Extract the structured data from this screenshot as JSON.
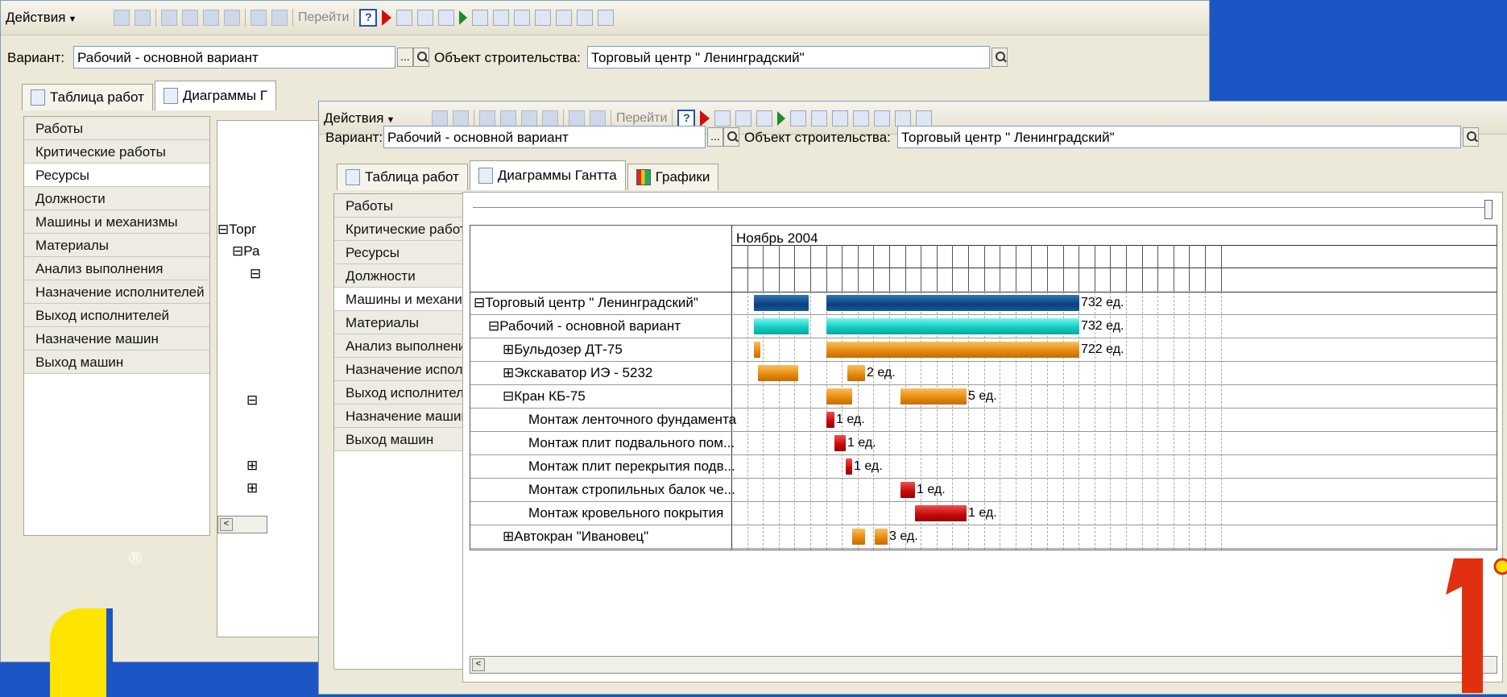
{
  "toolbar": {
    "actions_label": "Действия",
    "goto_label": "Перейти"
  },
  "variant": {
    "label": "Вариант:",
    "value": "Рабочий - основной вариант",
    "object_label": "Объект строительства:",
    "object_value": "Торговый центр \" Ленинградский\""
  },
  "tabs": [
    {
      "label": "Таблица работ"
    },
    {
      "label": "Диаграммы Гантта"
    },
    {
      "label": "Графики"
    }
  ],
  "back_tab_partial": "Диаграммы Г",
  "nav": [
    {
      "label": "Работы"
    },
    {
      "label": "Критические работы"
    },
    {
      "label": "Ресурсы"
    },
    {
      "label": "Должности"
    },
    {
      "label": "Машины и механизмы"
    },
    {
      "label": "Материалы"
    },
    {
      "label": "Анализ выполнения"
    },
    {
      "label": "Назначение исполнителей"
    },
    {
      "label": "Выход исполнителей"
    },
    {
      "label": "Назначение машин"
    },
    {
      "label": "Выход машин"
    }
  ],
  "back_tree": {
    "r1": "⊟Торг",
    "r2": "⊟Ра",
    "r3": "⊟",
    "r4": "⊟",
    "r5": "⊞",
    "r6": "⊞"
  },
  "gantt": {
    "month": "Ноябрь 2004",
    "rows": [
      {
        "name": "⊟Торговый центр \" Ленинградский\"",
        "qty": "732 ед."
      },
      {
        "name": "⊟Рабочий - основной вариант",
        "qty": "732 ед."
      },
      {
        "name": "⊞Бульдозер ДТ-75",
        "qty": "722 ед."
      },
      {
        "name": "⊞Экскаватор ИЭ - 5232",
        "qty": "2 ед."
      },
      {
        "name": "⊟Кран КБ-75",
        "qty": "5 ед."
      },
      {
        "name": "Монтаж ленточного фундамента",
        "qty": "1 ед."
      },
      {
        "name": "Монтаж плит подвального пом...",
        "qty": "1 ед."
      },
      {
        "name": "Монтаж плит перекрытия подв...",
        "qty": "1 ед."
      },
      {
        "name": "Монтаж стропильных балок че...",
        "qty": "1 ед."
      },
      {
        "name": "Монтаж кровельного покрытия",
        "qty": "1 ед."
      },
      {
        "name": "⊞Автокран \"Ивановец\"",
        "qty": "3 ед."
      }
    ]
  },
  "brand": {
    "registered_mark": "®",
    "accent": "#ffe400",
    "background": "#1c55c4",
    "logo_red": "#e03010"
  }
}
